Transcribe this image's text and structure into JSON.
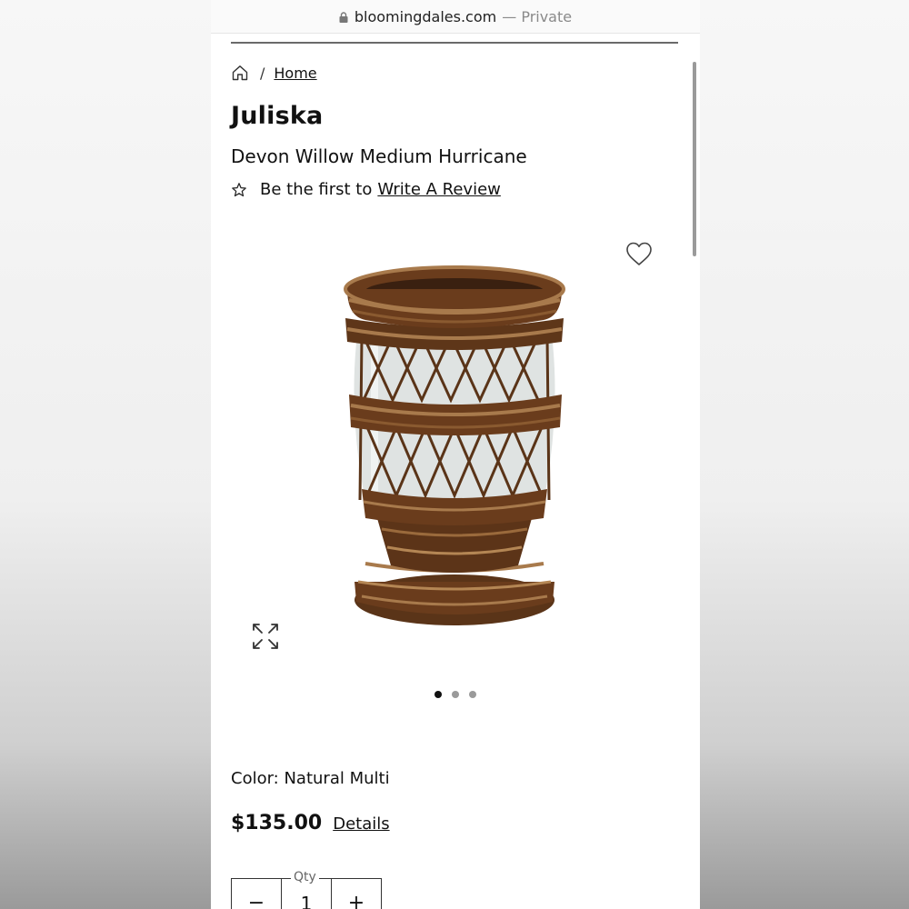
{
  "browser": {
    "domain": "bloomingdales.com",
    "privacy_label": "— Private",
    "lock_icon": "lock-icon"
  },
  "breadcrumb": {
    "home_icon": "home-icon",
    "separator": "/",
    "items": [
      {
        "label": "Home"
      }
    ]
  },
  "product": {
    "brand": "Juliska",
    "name": "Devon Willow Medium Hurricane",
    "review_prefix": "Be the first to",
    "review_link": "Write A Review",
    "color_label": "Color: Natural Multi",
    "price": "$135.00",
    "details_link": "Details"
  },
  "gallery": {
    "total_images": 3,
    "active_index": 0,
    "wishlist_icon": "heart-icon",
    "expand_icon": "expand-icon"
  },
  "quantity": {
    "label": "Qty",
    "value": "1",
    "minus": "−",
    "plus": "+"
  },
  "colors": {
    "wicker_dark": "#4a2a14",
    "wicker_mid": "#7a4a24",
    "wicker_light": "#a87a4c",
    "glass": "#dfe3e2"
  }
}
